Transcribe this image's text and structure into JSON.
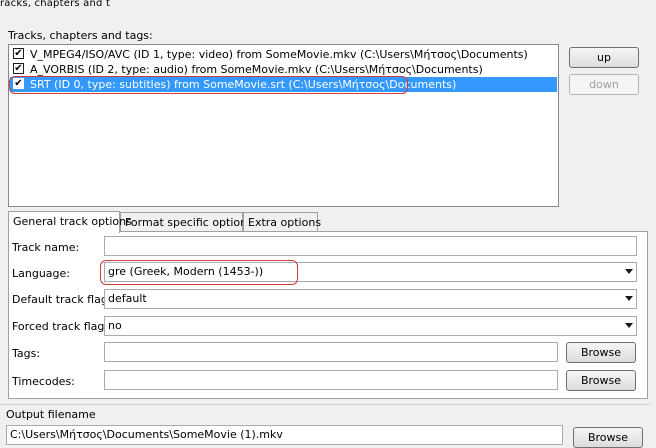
{
  "window": {
    "title_partial": "racks, chapters and t"
  },
  "tracks_section": {
    "label": "Tracks, chapters and tags:",
    "items": [
      {
        "checked": true,
        "selected": false,
        "label": "V_MPEG4/ISO/AVC (ID 1, type: video) from SomeMovie.mkv (C:\\Users\\Μήτσος\\Documents)"
      },
      {
        "checked": true,
        "selected": false,
        "label": "A_VORBIS (ID 2, type: audio) from SomeMovie.mkv (C:\\Users\\Μήτσος\\Documents)"
      },
      {
        "checked": true,
        "selected": true,
        "label": "SRT (ID 0, type: subtitles) from SomeMovie.srt (C:\\Users\\Μήτσος\\Documents)"
      }
    ],
    "up_label": "up",
    "down_label": "down"
  },
  "tabs": [
    {
      "label": "General track options",
      "active": true
    },
    {
      "label": "Format specific options",
      "active": false
    },
    {
      "label": "Extra options",
      "active": false
    }
  ],
  "general": {
    "track_name": {
      "label": "Track name:",
      "value": ""
    },
    "language": {
      "label": "Language:",
      "value": "gre (Greek, Modern (1453-))"
    },
    "default_flag": {
      "label": "Default track flag:",
      "value": "default"
    },
    "forced_flag": {
      "label": "Forced track flag:",
      "value": "no"
    },
    "tags": {
      "label": "Tags:",
      "value": "",
      "browse_label": "Browse"
    },
    "timecodes": {
      "label": "Timecodes:",
      "value": "",
      "browse_label": "Browse"
    }
  },
  "output": {
    "label": "Output filename",
    "value": "C:\\Users\\Μήτσος\\Documents\\SomeMovie (1).mkv",
    "browse_label": "Browse"
  },
  "colors": {
    "selection": "#3399ff",
    "highlight_outline": "#d43a3a"
  },
  "icons": {
    "checkbox": "check-icon",
    "dropdown": "chevron-down-icon"
  }
}
